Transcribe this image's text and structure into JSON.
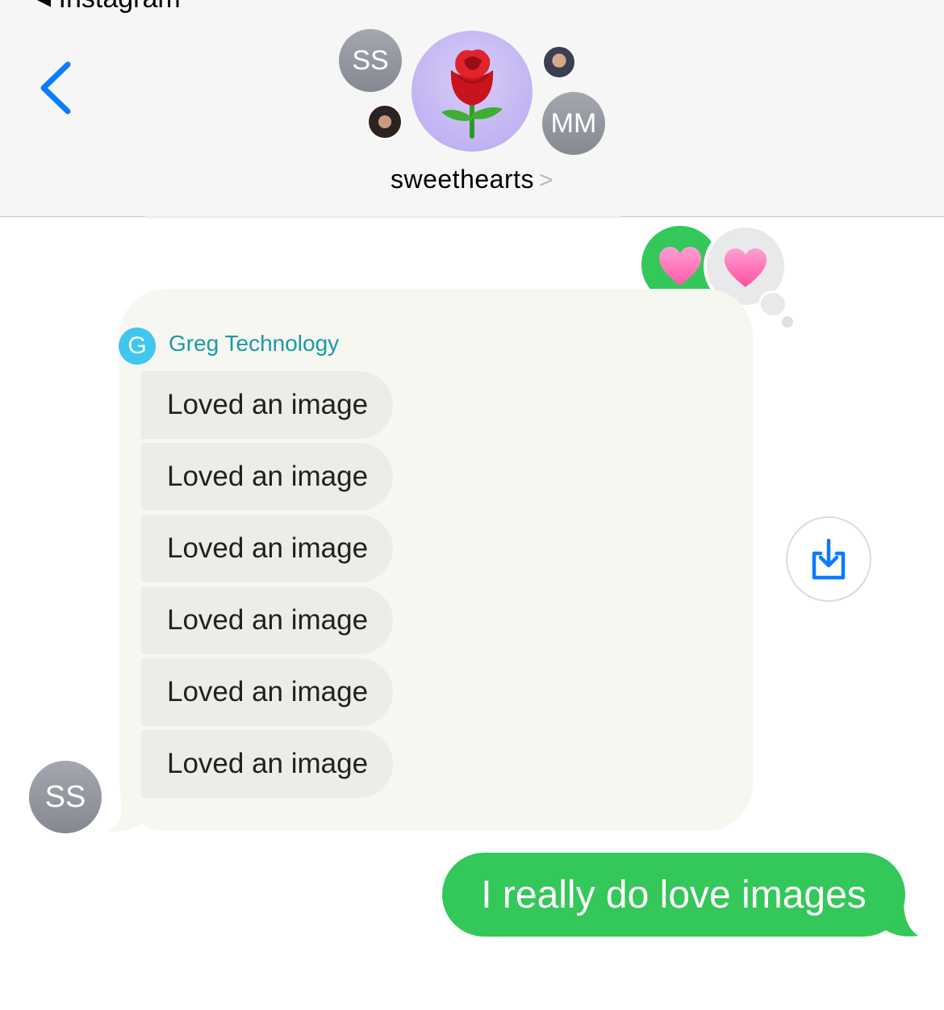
{
  "header": {
    "back_app_label": "◂ Instagram",
    "group_name": "sweethearts",
    "group_name_chevron": ">",
    "group_avatar_icon": "rose-icon",
    "participants": [
      {
        "initials": "SS"
      },
      {
        "initials": "MM"
      }
    ]
  },
  "reactions": {
    "icons": [
      "heart-icon",
      "heart-icon"
    ],
    "colors": {
      "green": "#34c759",
      "grey": "#e9e9eb",
      "heart": "#ff6fb5"
    }
  },
  "rcs_card": {
    "sender_logo_letter": "G",
    "sender_name": "Greg Technology",
    "items": [
      "Loved an image",
      "Loved an image",
      "Loved an image",
      "Loved an image",
      "Loved an image",
      "Loved an image"
    ],
    "sender_avatar_initials": "SS"
  },
  "save_button": {
    "icon": "save-to-device-icon",
    "color": "#0a7cff"
  },
  "sent_message": {
    "text": "I really do love images",
    "color": "#34c759"
  },
  "colors": {
    "accent": "#0a7cff",
    "sender_name": "#1a9aa9"
  }
}
